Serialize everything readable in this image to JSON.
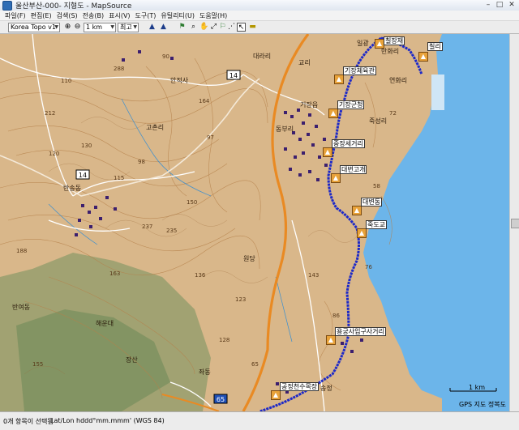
{
  "window": {
    "title": "울산부산-000- 지형도 - MapSource",
    "minimize": "–",
    "maximize": "□",
    "close": "✕"
  },
  "menu": [
    "파일(F)",
    "편집(E)",
    "검색(S)",
    "전송(B)",
    "표시(V)",
    "도구(T)",
    "유틸리티(U)",
    "도움말(H)"
  ],
  "toolbar": {
    "product": "Korea Topo v1",
    "scale": "1 km",
    "detail": "최고"
  },
  "map": {
    "road_shields": [
      "14",
      "14",
      "65"
    ],
    "waypoints": [
      "칠장재",
      "칠리",
      "기장체육관",
      "기장군청",
      "중장세거리",
      "대변고개",
      "대변동",
      "죽도교",
      "용궁사입구사거리",
      "공정천수목장"
    ],
    "scale_label": "1 km",
    "gps_label": "GPS 지도 정복도",
    "place_labels": [
      "기장읍",
      "대라리",
      "반송동",
      "고촌리",
      "해운대",
      "장산",
      "안적사",
      "만화리",
      "동부리",
      "교리",
      "죽성리",
      "연화리",
      "원당",
      "송정",
      "일광",
      "반여동",
      "좌동"
    ],
    "contour_labels": [
      "212",
      "288",
      "235",
      "164",
      "97",
      "115",
      "98",
      "130",
      "120",
      "163",
      "136",
      "188",
      "237",
      "123",
      "150",
      "128",
      "86",
      "58",
      "72",
      "143",
      "110",
      "76",
      "90",
      "65",
      "155"
    ]
  },
  "status": {
    "selection": "0개 항목이 선택됨",
    "coords": "Lat/Lon hddd°mm.mmm' (WGS 84)"
  },
  "colors": {
    "land": "#d9b78a",
    "sea": "#6cb5ea",
    "route": "#1d29c8",
    "highway": "#e98a23",
    "forest": "#6f8b5a"
  }
}
